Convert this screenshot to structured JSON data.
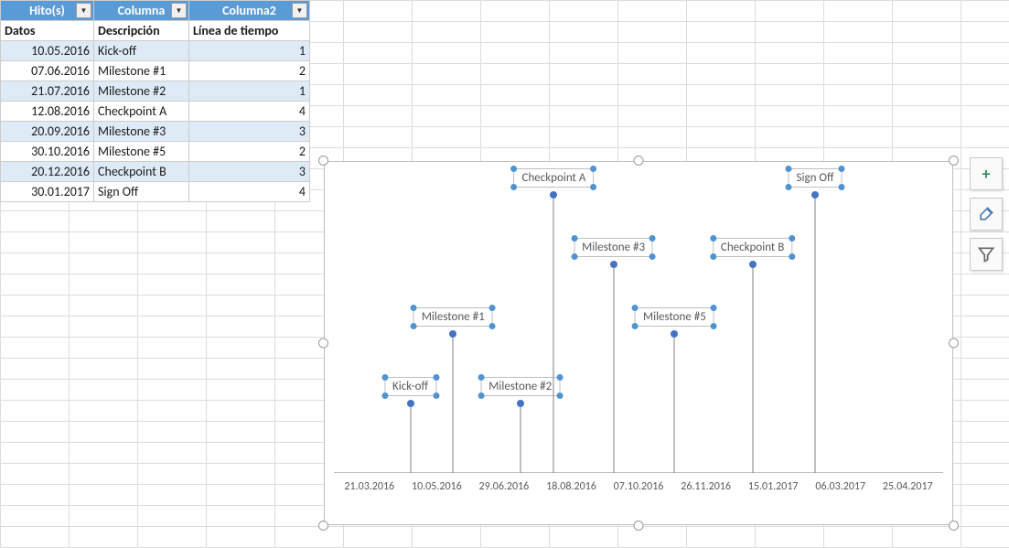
{
  "table": {
    "headers": [
      "Hito(s)",
      "Columna",
      "Columna2"
    ],
    "subheaders": [
      "Datos",
      "Descripción",
      "Línea de tiempo"
    ],
    "rows": [
      {
        "date": "10.05.2016",
        "desc": "Kick-off",
        "val": "1"
      },
      {
        "date": "07.06.2016",
        "desc": "Milestone #1",
        "val": "2"
      },
      {
        "date": "21.07.2016",
        "desc": "Milestone #2",
        "val": "1"
      },
      {
        "date": "12.08.2016",
        "desc": "Checkpoint A",
        "val": "4"
      },
      {
        "date": "20.09.2016",
        "desc": "Milestone #3",
        "val": "3"
      },
      {
        "date": "30.10.2016",
        "desc": "Milestone #5",
        "val": "2"
      },
      {
        "date": "20.12.2016",
        "desc": "Checkpoint B",
        "val": "3"
      },
      {
        "date": "30.01.2017",
        "desc": "Sign Off",
        "val": "4"
      }
    ]
  },
  "chart_data": {
    "type": "scatter",
    "title": "",
    "x_type": "date",
    "x_ticks": [
      "21.03.2016",
      "10.05.2016",
      "29.06.2016",
      "18.08.2016",
      "07.10.2016",
      "26.11.2016",
      "15.01.2017",
      "06.03.2017",
      "25.04.2017"
    ],
    "ylim": [
      0,
      4.5
    ],
    "x_range_days": [
      0,
      400
    ],
    "series": [
      {
        "name": "Línea de tiempo",
        "points": [
          {
            "x_days": 50,
            "y": 1,
            "label": "Kick-off"
          },
          {
            "x_days": 78,
            "y": 2,
            "label": "Milestone #1"
          },
          {
            "x_days": 122,
            "y": 1,
            "label": "Milestone #2"
          },
          {
            "x_days": 144,
            "y": 4,
            "label": "Checkpoint A"
          },
          {
            "x_days": 183,
            "y": 3,
            "label": "Milestone #3"
          },
          {
            "x_days": 223,
            "y": 2,
            "label": "Milestone #5"
          },
          {
            "x_days": 274,
            "y": 3,
            "label": "Checkpoint B"
          },
          {
            "x_days": 315,
            "y": 4,
            "label": "Sign Off"
          }
        ]
      }
    ]
  },
  "side_buttons": {
    "add": "+",
    "brush": "brush",
    "filter": "filter"
  }
}
